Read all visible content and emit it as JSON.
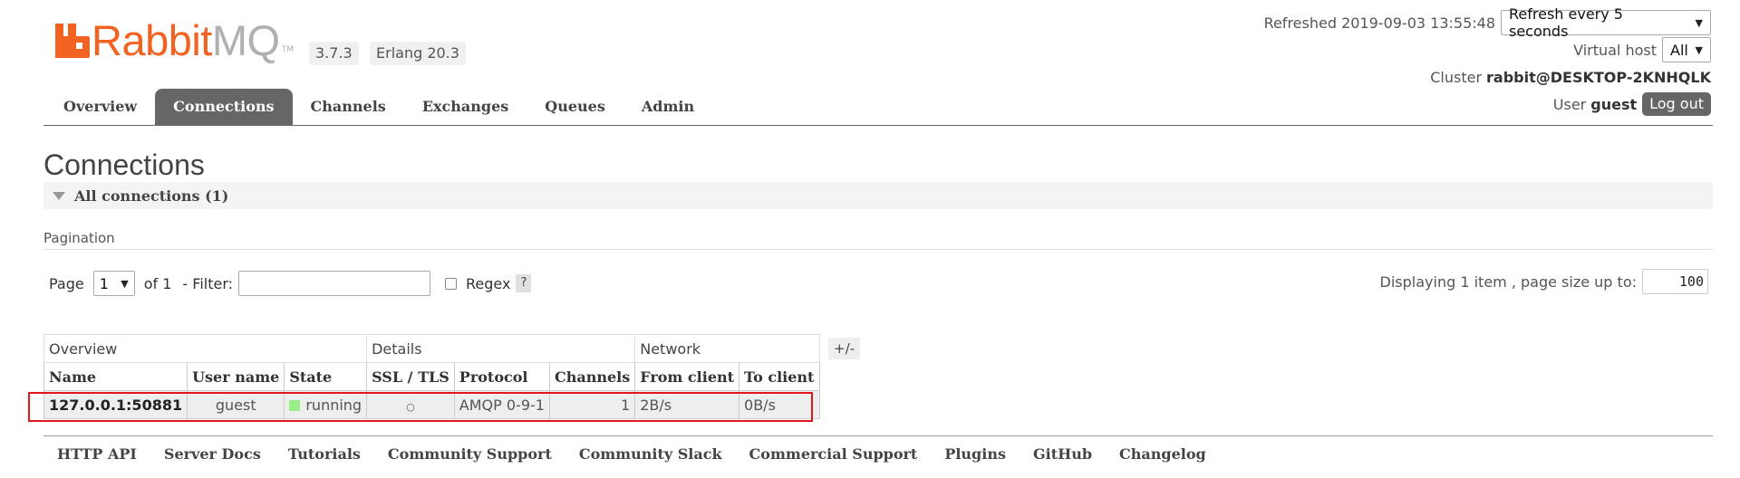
{
  "logo": {
    "word_rabbit": "Rabbit",
    "word_mq": "MQ",
    "tm": "TM"
  },
  "header": {
    "version": "3.7.3",
    "erlang": "Erlang 20.3",
    "refreshed_text": "Refreshed 2019-09-03 13:55:48",
    "refresh_option": "Refresh every 5 seconds",
    "vhost_label": "Virtual host",
    "vhost_value": "All",
    "cluster_label": "Cluster",
    "cluster_name": "rabbit@DESKTOP-2KNHQLK",
    "user_label": "User",
    "user_name": "guest",
    "logout_label": "Log out"
  },
  "tabs": [
    {
      "label": "Overview"
    },
    {
      "label": "Connections",
      "active": true
    },
    {
      "label": "Channels"
    },
    {
      "label": "Exchanges"
    },
    {
      "label": "Queues"
    },
    {
      "label": "Admin"
    }
  ],
  "page": {
    "title": "Connections",
    "section": "All connections (1)",
    "pagination_label": "Pagination",
    "page_label": "Page",
    "page_value": "1",
    "of_label": "of 1",
    "filter_label": "- Filter:",
    "filter_value": "",
    "regex_label": "Regex",
    "help": "?",
    "display_label": "Displaying 1 item , page size up to:",
    "page_size": "100"
  },
  "table": {
    "groups": [
      "Overview",
      "Details",
      "Network"
    ],
    "plus_minus": "+/-",
    "columns": [
      "Name",
      "User name",
      "State",
      "SSL / TLS",
      "Protocol",
      "Channels",
      "From client",
      "To client"
    ],
    "rows": [
      {
        "name": "127.0.0.1:50881",
        "user": "guest",
        "state": "running",
        "ssl": "○",
        "protocol": "AMQP 0-9-1",
        "channels": "1",
        "from_client": "2B/s",
        "to_client": "0B/s"
      }
    ]
  },
  "footer": [
    "HTTP API",
    "Server Docs",
    "Tutorials",
    "Community Support",
    "Community Slack",
    "Commercial Support",
    "Plugins",
    "GitHub",
    "Changelog"
  ],
  "colors": {
    "brand_orange": "#f26322",
    "tab_active": "#666666",
    "running": "#99ee88",
    "highlight": "#e0181e"
  }
}
